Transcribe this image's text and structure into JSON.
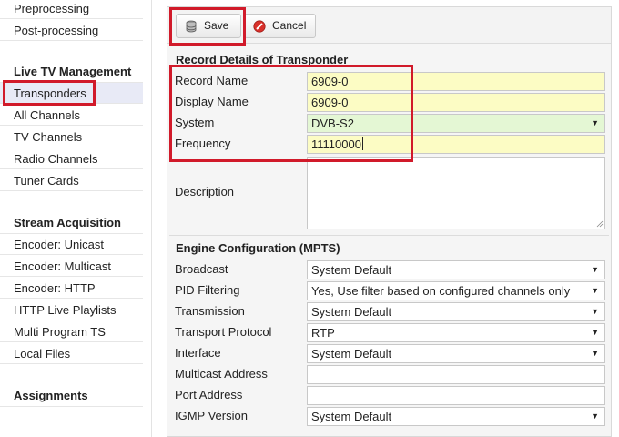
{
  "sidebar": {
    "top_items": [
      {
        "label": "Preprocessing"
      },
      {
        "label": "Post-processing"
      }
    ],
    "groups": [
      {
        "heading": "Live TV Management",
        "items": [
          {
            "label": "Transponders",
            "active": true
          },
          {
            "label": "All Channels"
          },
          {
            "label": "TV Channels"
          },
          {
            "label": "Radio Channels"
          },
          {
            "label": "Tuner Cards"
          }
        ]
      },
      {
        "heading": "Stream Acquisition",
        "items": [
          {
            "label": "Encoder: Unicast"
          },
          {
            "label": "Encoder: Multicast"
          },
          {
            "label": "Encoder: HTTP"
          },
          {
            "label": "HTTP Live Playlists"
          },
          {
            "label": "Multi Program TS"
          },
          {
            "label": "Local Files"
          }
        ]
      },
      {
        "heading": "Assignments",
        "items": []
      }
    ]
  },
  "toolbar": {
    "save_label": "Save",
    "save_icon": "database-save-icon",
    "cancel_label": "Cancel",
    "cancel_icon": "cancel-circle-icon"
  },
  "record": {
    "title": "Record Details of Transponder",
    "record_name": {
      "label": "Record Name",
      "value": "6909-0"
    },
    "display_name": {
      "label": "Display Name",
      "value": "6909-0"
    },
    "system": {
      "label": "System",
      "value": "DVB-S2"
    },
    "frequency": {
      "label": "Frequency",
      "value": "11110000"
    },
    "description": {
      "label": "Description",
      "value": ""
    }
  },
  "engine": {
    "title": "Engine Configuration (MPTS)",
    "broadcast": {
      "label": "Broadcast",
      "value": "System Default"
    },
    "pid_filtering": {
      "label": "PID Filtering",
      "value": "Yes, Use filter based on configured channels only"
    },
    "transmission": {
      "label": "Transmission",
      "value": "System Default"
    },
    "transport_protocol": {
      "label": "Transport Protocol",
      "value": "RTP"
    },
    "interface": {
      "label": "Interface",
      "value": "System Default"
    },
    "multicast_address": {
      "label": "Multicast Address",
      "value": ""
    },
    "port_address": {
      "label": "Port Address",
      "value": ""
    },
    "igmp_version": {
      "label": "IGMP Version",
      "value": "System Default"
    }
  },
  "colors": {
    "highlight": "#d11a2a",
    "required_field": "#fcfcc4",
    "valid_field": "#e4f7d4",
    "active_nav": "#e8eaf6"
  }
}
